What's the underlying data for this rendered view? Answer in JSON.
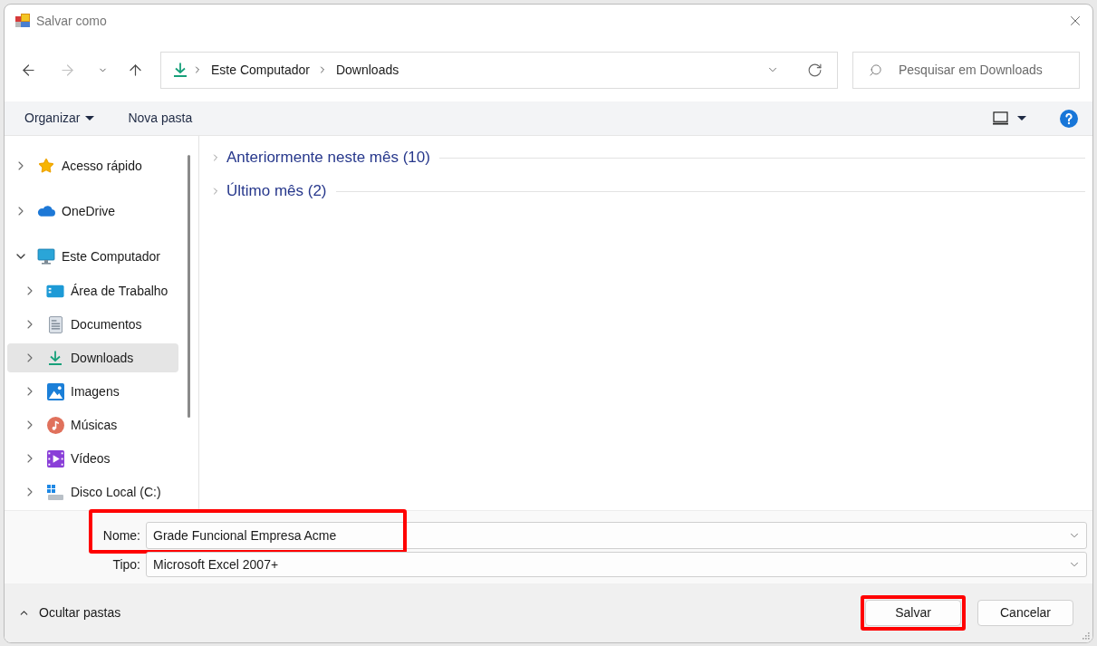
{
  "window": {
    "title": "Salvar como"
  },
  "navigation": {
    "buttons": [
      {
        "kind": "back",
        "disabled": false
      },
      {
        "kind": "forward",
        "disabled": true
      },
      {
        "kind": "recent",
        "disabled": false
      },
      {
        "kind": "up",
        "disabled": false
      }
    ],
    "address": {
      "path": [
        "Este Computador",
        "Downloads"
      ]
    },
    "search": {
      "placeholder": "Pesquisar em Downloads"
    }
  },
  "toolbar": {
    "items": [
      {
        "kind": "menu",
        "label": "Organizar"
      },
      {
        "kind": "button",
        "label": "Nova pasta"
      }
    ]
  },
  "sidebar": {
    "items": [
      {
        "kind": "quick_access",
        "label": "Acesso rápido",
        "expanded": false,
        "selected": false
      },
      {
        "kind": "cloud",
        "label": "OneDrive",
        "expanded": false,
        "selected": false
      },
      {
        "kind": "computer",
        "label": "Este Computador",
        "expanded": true,
        "selected": false,
        "children": [
          {
            "kind": "desktop",
            "label": "Área de Trabalho",
            "expanded": false,
            "selected": false
          },
          {
            "kind": "documents",
            "label": "Documentos",
            "expanded": false,
            "selected": false
          },
          {
            "kind": "downloads",
            "label": "Downloads",
            "expanded": false,
            "selected": true
          },
          {
            "kind": "pictures",
            "label": "Imagens",
            "expanded": false,
            "selected": false
          },
          {
            "kind": "music",
            "label": "Músicas",
            "expanded": false,
            "selected": false
          },
          {
            "kind": "videos",
            "label": "Vídeos",
            "expanded": false,
            "selected": false
          },
          {
            "kind": "drive",
            "label": "Disco Local (C:)",
            "expanded": false,
            "selected": false
          }
        ]
      }
    ]
  },
  "content": {
    "groups": [
      {
        "label": "Anteriormente neste mês (10)",
        "expanded": false
      },
      {
        "label": "Último mês (2)",
        "expanded": false
      }
    ]
  },
  "fields": [
    {
      "label": "Nome:",
      "value": "Grade Funcional Empresa Acme",
      "highlighted": true
    },
    {
      "label": "Tipo:",
      "value": "Microsoft Excel 2007+",
      "highlighted": false
    }
  ],
  "footer": {
    "toggle": {
      "label": "Ocultar pastas",
      "expanded": true
    },
    "buttons": [
      {
        "label": "Salvar",
        "highlighted": true
      },
      {
        "label": "Cancelar",
        "highlighted": false
      }
    ]
  }
}
